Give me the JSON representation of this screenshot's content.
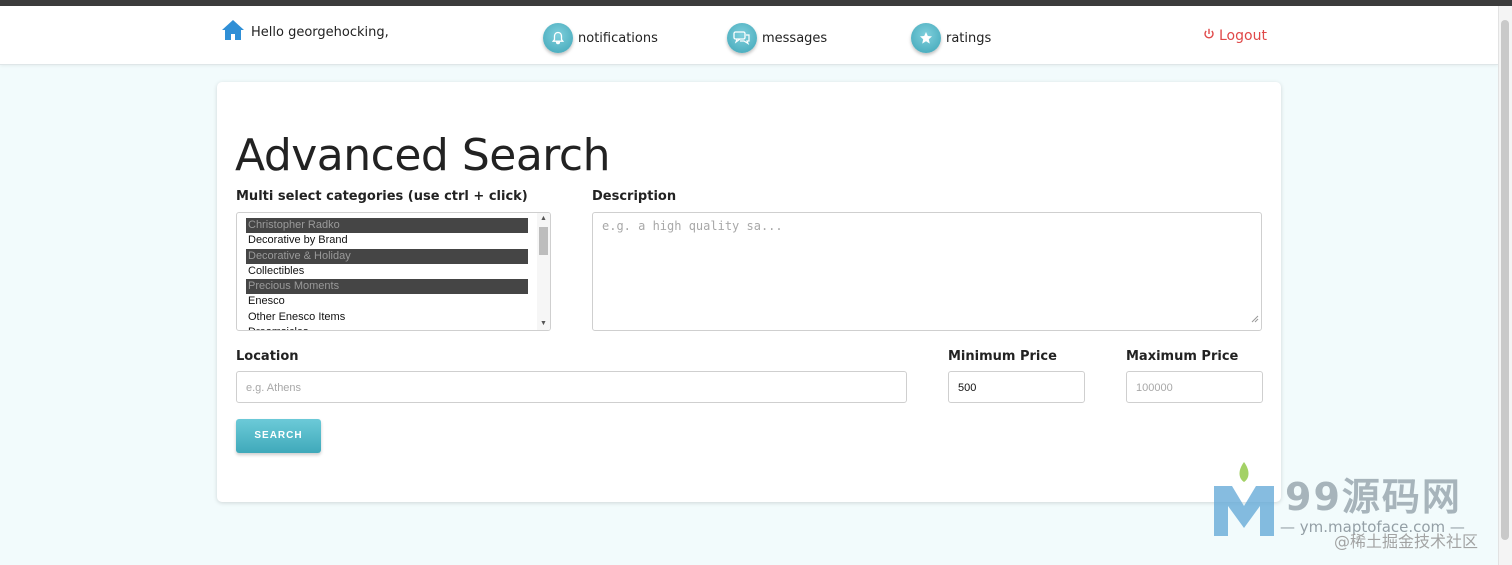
{
  "header": {
    "greeting": "Hello georgehocking,",
    "nav": [
      {
        "label": "notifications",
        "icon": "bell-icon"
      },
      {
        "label": "messages",
        "icon": "chat-bubbles-icon"
      },
      {
        "label": "ratings",
        "icon": "star-icon"
      }
    ],
    "logout_label": "Logout"
  },
  "colors": {
    "accent": "#46aebf",
    "logout": "#e04848",
    "background": "#f2fbfc"
  },
  "search": {
    "title": "Advanced Search",
    "categories": {
      "label": "Multi select categories (use ctrl + click)",
      "options": [
        {
          "label": "Christopher Radko",
          "selected": true
        },
        {
          "label": "Decorative by Brand",
          "selected": false
        },
        {
          "label": "Decorative & Holiday",
          "selected": true
        },
        {
          "label": "Collectibles",
          "selected": false
        },
        {
          "label": "Precious Moments",
          "selected": true
        },
        {
          "label": "Enesco",
          "selected": false
        },
        {
          "label": "Other Enesco Items",
          "selected": false
        },
        {
          "label": "Dreamsicles",
          "selected": false
        }
      ]
    },
    "description": {
      "label": "Description",
      "placeholder": "e.g. a high quality sa..."
    },
    "location": {
      "label": "Location",
      "placeholder": "e.g. Athens",
      "value": ""
    },
    "min_price": {
      "label": "Minimum Price",
      "value": "500"
    },
    "max_price": {
      "label": "Maximum Price",
      "placeholder": "100000",
      "value": ""
    },
    "button_label": "SEARCH"
  },
  "watermark": {
    "brand": "99源码网",
    "url": "— ym.maptoface.com —",
    "credit": "@稀土掘金技术社区"
  }
}
